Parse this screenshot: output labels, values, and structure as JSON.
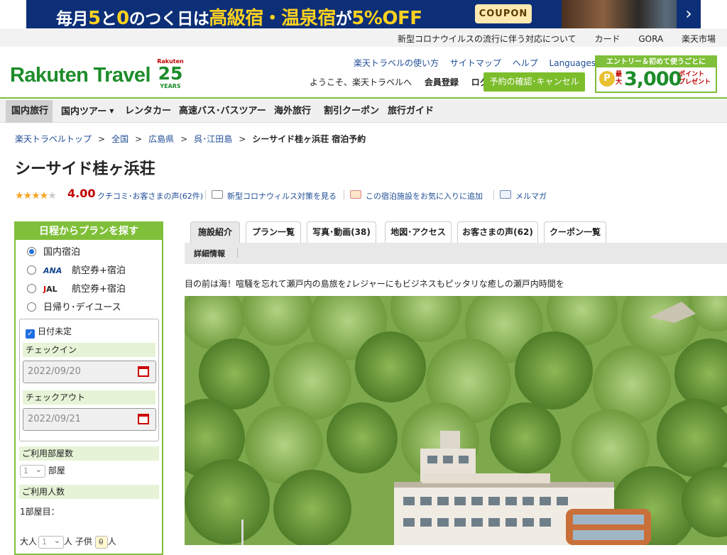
{
  "banner": {
    "text_prefix": "毎月",
    "text_five": "5",
    "text_to": "と",
    "text_zero": "0",
    "text_mid": "のつく日は",
    "text_highlight": "高級宿・温泉宿",
    "text_ga": "が",
    "text_off": "5%OFF",
    "coupon_label": "COUPON",
    "next_arrow": "›"
  },
  "utility_links": [
    "新型コロナウイルスの流行に伴う対応について",
    "カード",
    "GORA",
    "楽天市場"
  ],
  "header": {
    "logo_text": "Rakuten Travel",
    "anniv_rakuten": "Rakuten",
    "anniv_number": "25",
    "anniv_years": "YEARS",
    "nav": [
      "楽天トラベルの使い方",
      "サイトマップ",
      "ヘルプ",
      "Languages"
    ],
    "welcome": "ようこそ、楽天トラベルへ",
    "register": "会員登録",
    "login": "ログイン",
    "confirm_button": "予約の確認･キャンセル",
    "promo_top": "エントリー＆初めて使うごとに",
    "promo_coin": "P",
    "promo_pre": "最大",
    "promo_big": "3,000",
    "promo_suffix_1": "ポイント",
    "promo_suffix_2": "プレゼント"
  },
  "global_nav": [
    "国内旅行",
    "国内ツアー",
    "レンタカー",
    "高速バス･バスツアー",
    "海外旅行",
    "割引クーポン",
    "旅行ガイド"
  ],
  "breadcrumb": [
    "楽天トラベルトップ",
    "全国",
    "広島県",
    "呉･江田島"
  ],
  "breadcrumb_current": "シーサイド桂ヶ浜荘 宿泊予約",
  "breadcrumb_sep": ">",
  "hotel": {
    "name": "シーサイド桂ヶ浜荘",
    "stars_on": "★★★★",
    "stars_off": "★",
    "rating": 4.0,
    "score": "4.00",
    "reviews_link": "クチコミ･お客さまの声(62件)",
    "covid_link": "新型コロナウィルス対策を見る",
    "favorite_link": "この宿泊施設をお気に入りに追加",
    "mail_link": "メルマガ",
    "tagline": "目の前は海！喧騒を忘れて瀬戸内の島旅を♪レジャーにもビジネスもピッタリな癒しの瀬戸内時間を"
  },
  "search": {
    "title": "日程からプランを探す",
    "options": [
      {
        "label": "国内宿泊",
        "logo": ""
      },
      {
        "label": "航空券+宿泊",
        "logo": "ANA"
      },
      {
        "label": "航空券+宿泊",
        "logo": "JAL"
      },
      {
        "label": "日帰り･デイユース",
        "logo": ""
      }
    ],
    "undecided_label": "日付未定",
    "checkin_label": "チェックイン",
    "checkin_value": "2022/09/20",
    "checkout_label": "チェックアウト",
    "checkout_value": "2022/09/21",
    "rooms_label": "ご利用部屋数",
    "rooms_value": "1",
    "rooms_unit": "部屋",
    "guests_label": "ご利用人数",
    "room_1": "1部屋目：",
    "adults_label": "大人",
    "adults_value": "1",
    "adults_unit": "人",
    "children_label": "子供",
    "children_value": "0",
    "children_unit": "人"
  },
  "tabs": [
    "施設紹介",
    "プラン一覧",
    "写真･動画(38)",
    "地図･アクセス",
    "お客さまの声(62)",
    "クーポン一覧"
  ],
  "subtab": "詳細情報",
  "colors": {
    "brand_green": "#7fbf39",
    "logo_green": "#1d8c2a",
    "link_blue": "#1f4d96",
    "price_red": "#bf0000",
    "banner_navy": "#0d2f78"
  }
}
